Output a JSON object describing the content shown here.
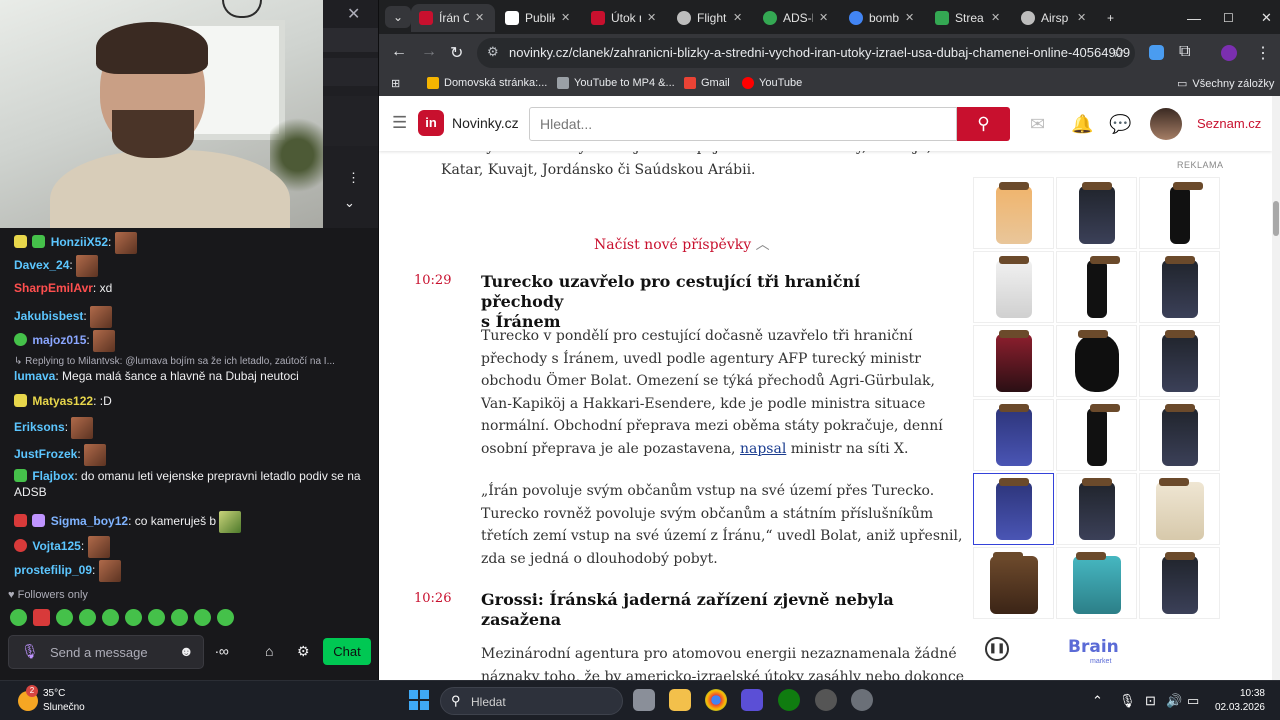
{
  "stream": {
    "followers_label": "Followers only",
    "message_placeholder": "Send a message",
    "chat_button": "Chat",
    "messages": [
      {
        "user": "HonziiX52",
        "text": "",
        "color": "#5cc6ff"
      },
      {
        "user": "Davex_24",
        "text": "",
        "color": "#5cc6ff"
      },
      {
        "user": "SharpEmilAvr",
        "text": "xd",
        "color": "#ff4f4f"
      },
      {
        "user": "Jakubisbest",
        "text": "",
        "color": "#5cc6ff"
      },
      {
        "user": "majoz015",
        "text": "",
        "color": "#8aa6ff"
      },
      {
        "user": "",
        "text": "Replying to Milantvsk: @lumava bojím sa že ich letadlo, zaútočí na I...",
        "color": "#adadb8"
      },
      {
        "user": "lumava",
        "text": "Mega malá šance a hlavně na Dubaj neutoci",
        "color": "#5cc6ff"
      },
      {
        "user": "Matyas122",
        "text": ":D",
        "color": "#e7d64b"
      },
      {
        "user": "Eriksons",
        "text": "",
        "color": "#5cc6ff"
      },
      {
        "user": "JustFrozek",
        "text": "",
        "color": "#5cc6ff"
      },
      {
        "user": "Flajbox",
        "text": "do omanu leti vejenske prepravni letadlo podiv se na",
        "color": "#5cc6ff"
      },
      {
        "user": "",
        "text": "ADSB",
        "color": "#efeff1"
      },
      {
        "user": "Sigma_boy12",
        "text": "co kameruješ b",
        "color": "#7fb3ff"
      },
      {
        "user": "Vojta125",
        "text": "",
        "color": "#5cc6ff"
      },
      {
        "user": "prostefilip_09",
        "text": "",
        "color": "#5cc6ff"
      }
    ]
  },
  "browser": {
    "tabs": [
      {
        "label": "Írán O",
        "color": "#c8102e"
      },
      {
        "label": "Publik",
        "color": "#ffffff"
      },
      {
        "label": "Útok n",
        "color": "#c8102e"
      },
      {
        "label": "Flight",
        "color": "#bdbdbd"
      },
      {
        "label": "ADS-B",
        "color": "#34a853"
      },
      {
        "label": "bomb",
        "color": "#4285f4"
      },
      {
        "label": "Strea",
        "color": "#34a853"
      },
      {
        "label": "Airsp",
        "color": "#bdbdbd"
      }
    ],
    "url": "novinky.cz/clanek/zahranicni-blizky-a-stredni-vychod-iran-utoky-izrael-usa-dubaj-chamenei-online-40564909",
    "bookmarks": [
      {
        "label": "Domovská stránka:...",
        "color": "#f4b400"
      },
      {
        "label": "YouTube to MP4 &...",
        "color": "#9aa0a6"
      },
      {
        "label": "Gmail",
        "color": "#ea4335"
      },
      {
        "label": "YouTube",
        "color": "#ff0000"
      }
    ],
    "all_bookmarks": "Všechny záložky"
  },
  "site": {
    "brand": "Novinky.cz",
    "logo": "in",
    "search_placeholder": "Hledat...",
    "seznam": "Seznam.cz",
    "ad_label": "REKLAMA",
    "ad_brand": "Brain",
    "ad_brand_sub": "market"
  },
  "article": {
    "intro_line1": "Desítky úderů mířily mimo jiné na Spojené arabské emiráty, Bahrajn,",
    "intro_line2": "Katar, Kuvajt, Jordánsko či Saúdskou Arábii.",
    "load_more": "Načíst nové příspěvky",
    "posts": [
      {
        "time": "10:29",
        "title_1": "Turecko uzavřelo pro cestující tři hraniční přechody",
        "title_2": "s Íránem",
        "p1": [
          "Turecko v pondělí pro cestující dočasně uzavřelo tři hraniční",
          "přechody s Íránem, uvedl podle agentury AFP turecký ministr",
          "obchodu Ömer Bolat. Omezení se týká přechodů Agri-Gürbulak,",
          "Van-Kapiköj a Hakkari-Esendere, kde je podle ministra situace",
          "normální. Obchodní přeprava mezi oběma státy pokračuje, denní"
        ],
        "p1_last_a": "osobní přeprava je ale pozastavena, ",
        "p1_link": "napsal",
        "p1_last_b": " ministr na síti X.",
        "p2": [
          "„Írán povoluje svým občanům vstup na své území přes Turecko.",
          "Turecko rovněž povoluje svým občanům a státním příslušníkům",
          "třetích zemí vstup na své území z Íránu,“ uvedl Bolat, aniž upřesnil,",
          "zda se jedná o dlouhodobý pobyt."
        ]
      },
      {
        "time": "10:26",
        "title_1": "Grossi: Íránská jaderná zařízení zjevně nebyla",
        "title_2": "zasažena",
        "p1": [
          "Mezinárodní agentura pro atomovou energii nezaznamenala žádné",
          "náznaky toho, že by americko-izraelské útoky zasáhly nebo dokonce"
        ]
      }
    ]
  },
  "taskbar": {
    "temp": "35°C",
    "weather": "Slunečno",
    "weather_badge": "2",
    "search_placeholder": "Hledat",
    "time": "10:38",
    "date": "02.03.2026"
  }
}
